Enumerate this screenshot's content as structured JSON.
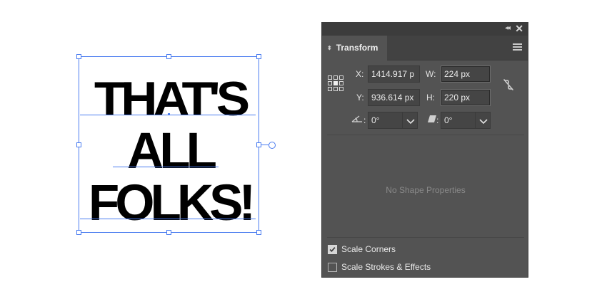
{
  "artwork": {
    "line1": "THAT'S",
    "line2": "ALL",
    "line3": "FOLKS!"
  },
  "panel": {
    "title": "Transform",
    "x_label": "X:",
    "x_value": "1414.917 p",
    "y_label": "Y:",
    "y_value": "936.614 px",
    "w_label": "W:",
    "w_value": "224 px",
    "h_label": "H:",
    "h_value": "220 px",
    "rotate_value": "0°",
    "shear_value": "0°",
    "no_shape_text": "No Shape Properties",
    "scale_corners": {
      "label": "Scale Corners",
      "checked": true
    },
    "scale_strokes": {
      "label": "Scale Strokes & Effects",
      "checked": false
    }
  },
  "colors": {
    "selection": "#4a7cf0",
    "panel_bg": "#535353",
    "panel_dark": "#3c3c3c"
  }
}
